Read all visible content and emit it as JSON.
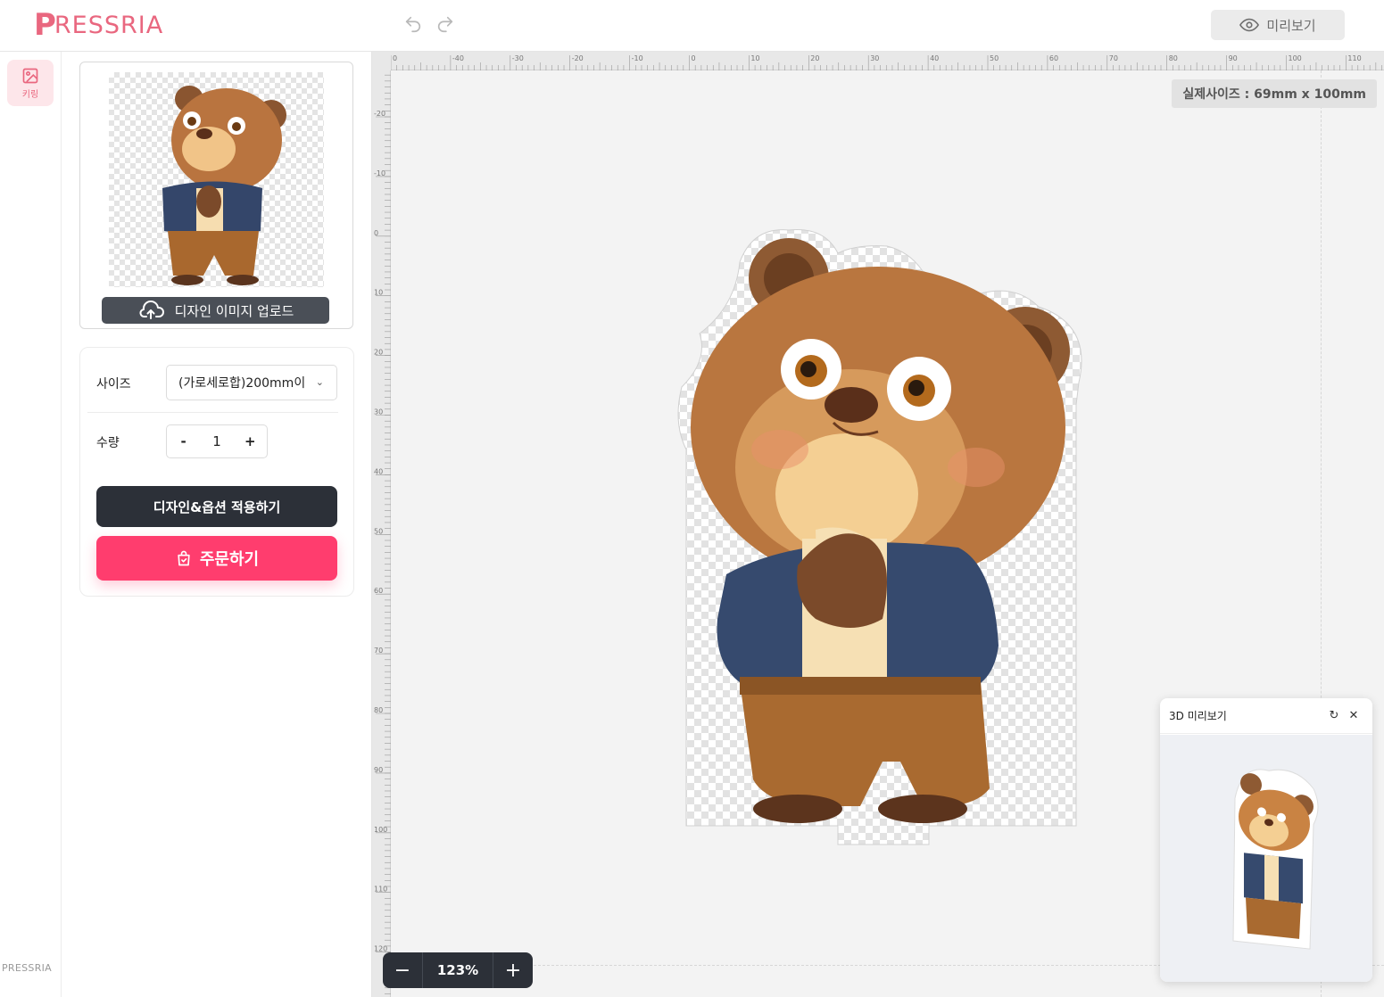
{
  "header": {
    "logo_text": "RESSRIA",
    "logo_initial": "P",
    "preview_label": "미리보기"
  },
  "rail": {
    "items": [
      {
        "label": "키링",
        "icon": "image-icon"
      }
    ],
    "footer_logo": "PRESSRIA"
  },
  "panel": {
    "upload_label": "디자인 이미지 업로드",
    "size_label": "사이즈",
    "size_value": "(가로세로합)200mm이",
    "qty_label": "수량",
    "qty_minus": "-",
    "qty_value": "1",
    "qty_plus": "+",
    "apply_label": "디자인&옵션 적용하기",
    "order_label": "주문하기"
  },
  "canvas": {
    "real_size": "실제사이즈 : 69mm x 100mm",
    "zoom": "123%",
    "zoom_minus": "−",
    "zoom_plus": "+",
    "ruler_top_labels": [
      "0",
      "-40",
      "-30",
      "-20",
      "-10",
      "0",
      "10",
      "20",
      "30",
      "40",
      "50",
      "60",
      "70",
      "80",
      "90",
      "100",
      "110"
    ],
    "ruler_left_labels": [
      "-20",
      "-10",
      "0",
      "10",
      "20",
      "30",
      "40",
      "50",
      "60",
      "70",
      "80",
      "90",
      "100",
      "110",
      "120"
    ]
  },
  "preview3d": {
    "title": "3D 미리보기",
    "refresh_icon": "refresh-icon",
    "close_icon": "close-icon"
  },
  "colors": {
    "brand": "#e9677f",
    "order": "#ff3d6e",
    "dark": "#2c3038"
  }
}
